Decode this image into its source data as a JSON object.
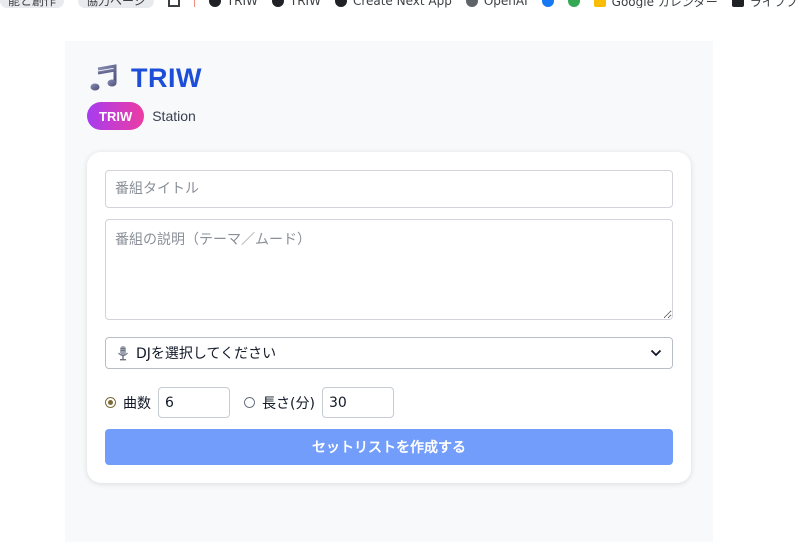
{
  "app": {
    "title": "TRIW",
    "badge": "TRIW",
    "subtitle": "Station",
    "title_color": "#1d4ed8",
    "badge_gradient": [
      "#a73cf0",
      "#ec3ca2"
    ]
  },
  "bookmarks": [
    {
      "label": "能と創作"
    },
    {
      "label": "協力ページ"
    },
    {
      "label": "TRIW"
    },
    {
      "label": "TRIW"
    },
    {
      "label": "Create Next App"
    },
    {
      "label": "OpenAI"
    },
    {
      "label": "Google カレンダー"
    },
    {
      "label": "ライフプラ"
    }
  ],
  "form": {
    "title_placeholder": "番組タイトル",
    "description_placeholder": "番組の説明（テーマ／ムード）",
    "dj_select": {
      "selected": "DJを選択してください",
      "icon": "microphone-icon"
    },
    "mode_tracks_label": "曲数",
    "mode_tracks_selected": true,
    "tracks_value": "6",
    "mode_length_label": "長さ(分)",
    "length_value": "30",
    "submit_label": "セットリストを作成する",
    "submit_color": "#729dfa"
  }
}
